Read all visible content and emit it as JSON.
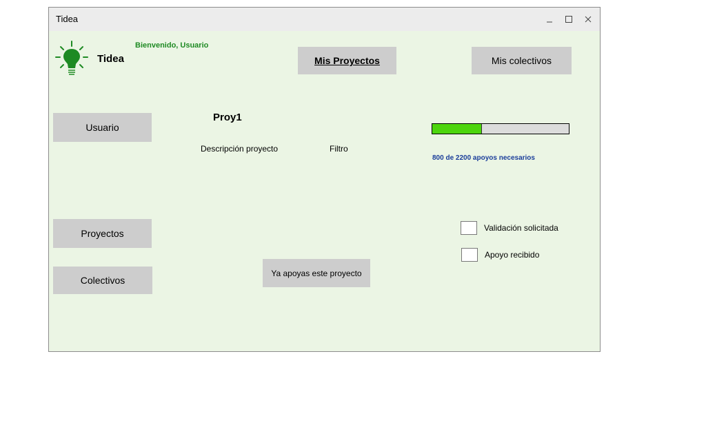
{
  "window": {
    "title": "Tidea",
    "controls": {
      "minimize_icon": "minimize-icon",
      "maximize_icon": "maximize-icon",
      "close_icon": "close-icon"
    }
  },
  "header": {
    "logo_text": "Tidea",
    "logo_icon": "lightbulb-icon",
    "welcome": "Bienvenido, Usuario",
    "mis_proyectos": "Mis Proyectos",
    "mis_colectivos": "Mis colectivos"
  },
  "sidebar": {
    "usuario": "Usuario",
    "proyectos": "Proyectos",
    "colectivos": "Colectivos"
  },
  "project": {
    "name": "Proy1",
    "description": "Descripción proyecto",
    "filter": "Filtro",
    "support_text": "800 de 2200 apoyos necesarios",
    "support_current": 800,
    "support_needed": 2200,
    "support_button": "Ya apoyas este proyecto"
  },
  "checkboxes": [
    {
      "label": "Validación solicitada",
      "checked": false
    },
    {
      "label": "Apoyo recibido",
      "checked": false
    }
  ],
  "colors": {
    "window_bg": "#ebf5e4",
    "button_bg": "#cdcdcd",
    "logo_green": "#1e8a23",
    "progress_fill": "#4cd50c",
    "support_text": "#1a3d9a"
  }
}
